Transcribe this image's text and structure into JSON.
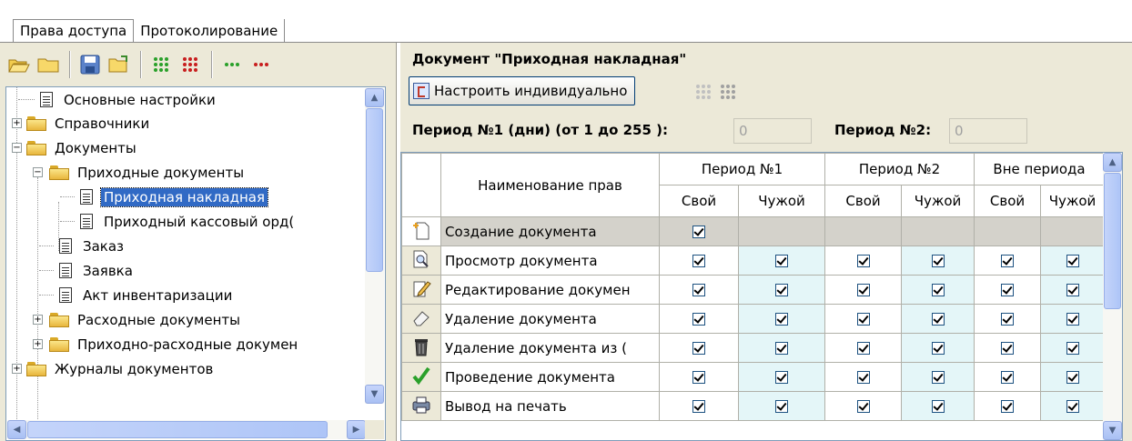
{
  "tabs": [
    {
      "label": "Права доступа",
      "active": true
    },
    {
      "label": "Протоколирование",
      "active": false
    }
  ],
  "toolbar": {
    "icons": [
      "open-folder-icon",
      "folder-icon",
      "save-icon",
      "open-file-icon",
      "green-dots-icon",
      "red-dots-icon",
      "green-small-dots-icon",
      "red-small-dots-icon"
    ]
  },
  "tree": {
    "items": [
      {
        "label": "Основные настройки",
        "type": "doc",
        "level": 1
      },
      {
        "label": "Справочники",
        "type": "folder",
        "level": 0,
        "expander": "+"
      },
      {
        "label": "Документы",
        "type": "folder",
        "level": 0,
        "expander": "−"
      },
      {
        "label": "Приходные документы",
        "type": "folder",
        "level": 1,
        "expander": "−"
      },
      {
        "label": "Приходная накладная",
        "type": "doc",
        "level": 2,
        "selected": true
      },
      {
        "label": "Приходный кассовый орд(",
        "type": "doc",
        "level": 2
      },
      {
        "label": "Заказ",
        "type": "doc",
        "level": 1
      },
      {
        "label": "Заявка",
        "type": "doc",
        "level": 1
      },
      {
        "label": "Акт инвентаризации",
        "type": "doc",
        "level": 1
      },
      {
        "label": "Расходные документы",
        "type": "folder",
        "level": 1,
        "expander": "+"
      },
      {
        "label": "Приходно-расходные докумен",
        "type": "folder",
        "level": 1,
        "expander": "+"
      },
      {
        "label": "Журналы документов",
        "type": "folder",
        "level": 0,
        "expander": "+"
      }
    ]
  },
  "right": {
    "title": "Документ \"Приходная накладная\"",
    "individual_button": "Настроить индивидуально",
    "period1_label": "Период №1 (дни) (от 1 до 255 ):",
    "period1_value": "0",
    "period2_label": "Период №2:",
    "period2_value": "0"
  },
  "table": {
    "name_header": "Наименование прав",
    "groups": [
      "Период №1",
      "Период №2",
      "Вне периода"
    ],
    "sub": [
      "Свой",
      "Чужой",
      "Свой",
      "Чужой",
      "Свой",
      "Чужой"
    ],
    "rows": [
      {
        "icon": "create-document-icon",
        "name": "Создание документа",
        "checks": [
          true,
          null,
          null,
          null,
          null,
          null
        ]
      },
      {
        "icon": "view-document-icon",
        "name": "Просмотр документа",
        "checks": [
          true,
          true,
          true,
          true,
          true,
          true
        ]
      },
      {
        "icon": "edit-document-icon",
        "name": "Редактирование докумен",
        "checks": [
          true,
          true,
          true,
          true,
          true,
          true
        ]
      },
      {
        "icon": "eraser-icon",
        "name": "Удаление документа",
        "checks": [
          true,
          true,
          true,
          true,
          true,
          true
        ]
      },
      {
        "icon": "trash-icon",
        "name": "Удаление документа из (",
        "checks": [
          true,
          true,
          true,
          true,
          true,
          true
        ]
      },
      {
        "icon": "checkmark-icon",
        "name": "Проведение документа",
        "checks": [
          true,
          true,
          true,
          true,
          true,
          true
        ]
      },
      {
        "icon": "printer-icon",
        "name": "Вывод на печать",
        "checks": [
          true,
          true,
          true,
          true,
          true,
          true
        ]
      }
    ]
  }
}
